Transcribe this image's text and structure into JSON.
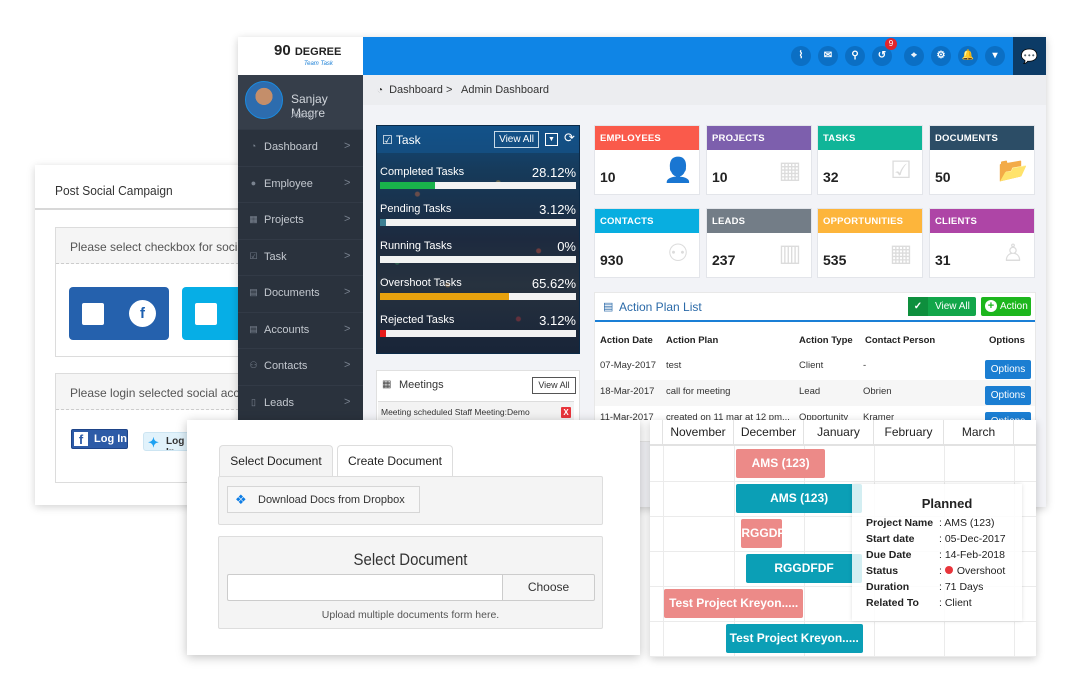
{
  "social_campaign": {
    "title": "Post Social Campaign",
    "select_prompt": "Please select checkbox for social campaign",
    "login_prompt": "Please login selected social account",
    "facebook_login": "Log In",
    "twitter_login": "Log In",
    "facebook_glyph": "f",
    "twitter_glyph": "🐦"
  },
  "app": {
    "logo_main": "90",
    "logo_word": "DEGREE",
    "logo_sub": "Team Task",
    "topbar_icons": [
      {
        "name": "rss-icon",
        "glyph": "⌇"
      },
      {
        "name": "mail-icon",
        "glyph": "✉"
      },
      {
        "name": "search-icon",
        "glyph": "⚲"
      },
      {
        "name": "history-icon",
        "glyph": "↺"
      },
      {
        "name": "location-icon",
        "glyph": "⌖"
      },
      {
        "name": "gear-icon",
        "glyph": "⚙"
      },
      {
        "name": "bell-icon",
        "glyph": "🔔"
      },
      {
        "name": "caret-down-icon",
        "glyph": "▾"
      }
    ],
    "notification_count": "9",
    "chat_glyph": "💬",
    "user": {
      "name": "Sanjay Magre",
      "role": "Admin"
    },
    "sidebar": [
      {
        "label": "Dashboard",
        "icon": "dashboard-icon",
        "glyph": "◔"
      },
      {
        "label": "Employee",
        "icon": "user-icon",
        "glyph": "●"
      },
      {
        "label": "Projects",
        "icon": "table-icon",
        "glyph": "▦"
      },
      {
        "label": "Task",
        "icon": "checkbox-icon",
        "glyph": "☑"
      },
      {
        "label": "Documents",
        "icon": "list-icon",
        "glyph": "▤"
      },
      {
        "label": "Accounts",
        "icon": "list-icon",
        "glyph": "▤"
      },
      {
        "label": "Contacts",
        "icon": "users-icon",
        "glyph": "⚇"
      },
      {
        "label": "Leads",
        "icon": "tablet-icon",
        "glyph": "▯"
      }
    ],
    "chevron": ">",
    "breadcrumb": {
      "root": "Dashboard",
      "separator": ">",
      "current": "Admin Dashboard"
    },
    "task_panel": {
      "title": "Task",
      "view_all": "View All",
      "rows": [
        {
          "label": "Completed Tasks",
          "percent_text": "28.12%",
          "percent": 28.12,
          "color": "#19b24b"
        },
        {
          "label": "Pending Tasks",
          "percent_text": "3.12%",
          "percent": 3.12,
          "color": "#3d7f93"
        },
        {
          "label": "Running Tasks",
          "percent_text": "0%",
          "percent": 0,
          "color": "#19b24b"
        },
        {
          "label": "Overshoot Tasks",
          "percent_text": "65.62%",
          "percent": 65.62,
          "color": "#e7a10e"
        },
        {
          "label": "Rejected Tasks",
          "percent_text": "3.12%",
          "percent": 3.12,
          "color": "#e81b1b"
        }
      ]
    },
    "meetings": {
      "title": "Meetings",
      "view_all": "View All",
      "item": "Meeting scheduled Staff Meeting:Demo",
      "delete": "X"
    },
    "stats": [
      {
        "label": "EMPLOYEES",
        "value": "10",
        "color": "#fa5a4b",
        "icon": "user-icon",
        "glyph": "👤"
      },
      {
        "label": "PROJECTS",
        "value": "10",
        "color": "#7d5fad",
        "icon": "table-icon",
        "glyph": "▦"
      },
      {
        "label": "TASKS",
        "value": "32",
        "color": "#10b598",
        "icon": "checkbox-icon",
        "glyph": "☑"
      },
      {
        "label": "DOCUMENTS",
        "value": "50",
        "color": "#2c4d66",
        "icon": "folder-open-icon",
        "glyph": "📂"
      },
      {
        "label": "CONTACTS",
        "value": "930",
        "color": "#08aee0",
        "icon": "users-icon",
        "glyph": "⚇"
      },
      {
        "label": "LEADS",
        "value": "237",
        "color": "#737d87",
        "icon": "building-icon",
        "glyph": "▥"
      },
      {
        "label": "OPPORTUNITIES",
        "value": "535",
        "color": "#fdb53b",
        "icon": "th-icon",
        "glyph": "▦"
      },
      {
        "label": "CLIENTS",
        "value": "31",
        "color": "#ae45a6",
        "icon": "male-icon",
        "glyph": "♙"
      }
    ],
    "action_plan": {
      "title": "Action Plan List",
      "view_all": "View All",
      "add": "Action",
      "columns": [
        "Action Date",
        "Action Plan",
        "Action Type",
        "Contact Person",
        "Options"
      ],
      "rows": [
        {
          "date": "07-May-2017",
          "plan": "test",
          "type": "Client",
          "contact": "-",
          "option": "Options"
        },
        {
          "date": "18-Mar-2017",
          "plan": "call for meeting",
          "type": "Lead",
          "contact": "Obrien",
          "option": "Options"
        },
        {
          "date": "11-Mar-2017",
          "plan": "created on 11 mar at 12 pm...",
          "type": "Opportunity",
          "contact": "Kramer",
          "option": "Options"
        }
      ]
    }
  },
  "document_dialog": {
    "tabs": [
      "Select Document",
      "Create Document"
    ],
    "active_tab": "Select Document",
    "dropbox_button": "Download Docs from Dropbox",
    "select_title": "Select Document",
    "file_value": "",
    "choose_button": "Choose",
    "hint": "Upload multiple documents form here."
  },
  "gantt": {
    "months": [
      "November",
      "December",
      "January",
      "February",
      "March"
    ],
    "bars": [
      {
        "label": "AMS (123)",
        "kind": "planned"
      },
      {
        "label": "AMS (123)",
        "kind": "actual"
      },
      {
        "label": "RGGDFDF",
        "kind": "planned"
      },
      {
        "label": "RGGDFDF",
        "kind": "actual"
      },
      {
        "label": "Test Project Kreyon.....",
        "kind": "planned"
      },
      {
        "label": "Test Project Kreyon.....",
        "kind": "actual"
      }
    ],
    "tooltip": {
      "title": "Planned",
      "fields": [
        {
          "key": "Project Name",
          "value": "AMS (123)"
        },
        {
          "key": "Start date",
          "value": "05-Dec-2017"
        },
        {
          "key": "Due Date",
          "value": "14-Feb-2018"
        },
        {
          "key": "Status",
          "value": "Overshoot",
          "status_color": "#e8353b"
        },
        {
          "key": "Duration",
          "value": "71 Days"
        },
        {
          "key": "Related To",
          "value": "Client"
        }
      ]
    }
  }
}
